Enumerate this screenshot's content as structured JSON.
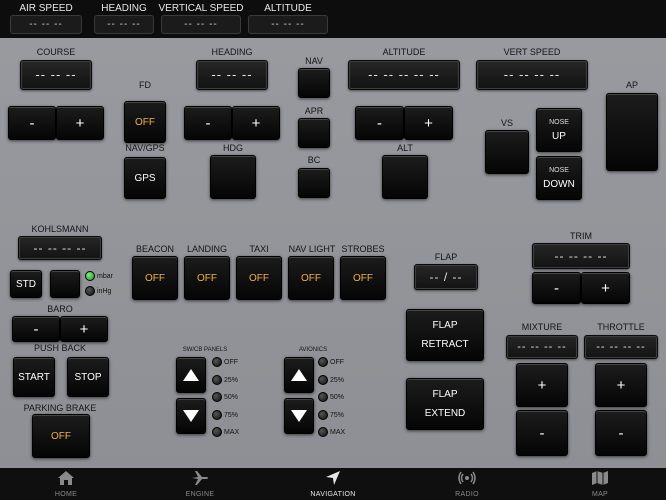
{
  "topbar": {
    "airspeed": {
      "label": "AIR SPEED",
      "value": "-- -- --"
    },
    "heading": {
      "label": "HEADING",
      "value": "-- -- --"
    },
    "vspeed": {
      "label": "VERTICAL SPEED",
      "value": "-- -- --"
    },
    "altitude": {
      "label": "ALTITUDE",
      "value": "-- -- --"
    }
  },
  "course": {
    "label": "COURSE",
    "value": "-- -- --",
    "minus": "-",
    "plus": "+"
  },
  "fd": {
    "label": "FD",
    "state": "OFF"
  },
  "navgps": {
    "label": "NAV/GPS",
    "value": "GPS"
  },
  "heading": {
    "label": "HEADING",
    "value": "-- -- --",
    "minus": "-",
    "plus": "+"
  },
  "hdg": {
    "label": "HDG"
  },
  "nav": {
    "label": "NAV"
  },
  "apr": {
    "label": "APR"
  },
  "bc": {
    "label": "BC"
  },
  "altitude": {
    "label": "ALTITUDE",
    "value": "-- -- -- -- --",
    "minus": "-",
    "plus": "+"
  },
  "alt": {
    "label": "ALT"
  },
  "vertspeed": {
    "label": "VERT SPEED",
    "value": "-- -- -- --"
  },
  "vs": {
    "label": "VS"
  },
  "nose_up": {
    "small": "NOSE",
    "label": "UP"
  },
  "nose_down": {
    "small": "NOSE",
    "label": "DOWN"
  },
  "ap": {
    "label": "AP"
  },
  "kohlsmann": {
    "label": "KOHLSMANN",
    "value": "-- -- -- --",
    "std": "STD",
    "mbar": "mbar",
    "inhg": "inHg"
  },
  "baro": {
    "label": "BARO",
    "minus": "-",
    "plus": "+"
  },
  "pushback": {
    "label": "PUSH BACK",
    "start": "START",
    "stop": "STOP"
  },
  "parking": {
    "label": "PARKING BRAKE",
    "state": "OFF"
  },
  "lights": [
    {
      "label": "BEACON",
      "state": "OFF"
    },
    {
      "label": "LANDING",
      "state": "OFF"
    },
    {
      "label": "TAXI",
      "state": "OFF"
    },
    {
      "label": "NAV LIGHT",
      "state": "OFF"
    },
    {
      "label": "STROBES",
      "state": "OFF"
    }
  ],
  "flap": {
    "label": "FLAP",
    "value": "-- / --",
    "retract": [
      "FLAP",
      "RETRACT"
    ],
    "extend": [
      "FLAP",
      "EXTEND"
    ]
  },
  "trim": {
    "label": "TRIM",
    "value": "-- -- -- --",
    "minus": "-",
    "plus": "+"
  },
  "swcb": {
    "label": "SW/CB PANELS",
    "levels": [
      "OFF",
      "25%",
      "50%",
      "75%",
      "MAX"
    ]
  },
  "avionics": {
    "label": "AVIONICS",
    "levels": [
      "OFF",
      "25%",
      "50%",
      "75%",
      "MAX"
    ]
  },
  "mixture": {
    "label": "MIXTURE",
    "value": "-- -- -- --",
    "plus": "+",
    "minus": "-"
  },
  "throttle": {
    "label": "THROTTLE",
    "value": "-- -- -- --",
    "plus": "+",
    "minus": "-"
  },
  "navbar": [
    {
      "label": "HOME",
      "icon": "home-icon"
    },
    {
      "label": "ENGINE",
      "icon": "airplane-icon"
    },
    {
      "label": "NAVIGATION",
      "icon": "navigation-arrow-icon"
    },
    {
      "label": "RADIO",
      "icon": "radio-waves-icon"
    },
    {
      "label": "MAP",
      "icon": "map-icon"
    }
  ],
  "colors": {
    "accent_orange": "#f2b04b",
    "led_green": "#3fd13f",
    "panel_grey": "#8f9196"
  }
}
